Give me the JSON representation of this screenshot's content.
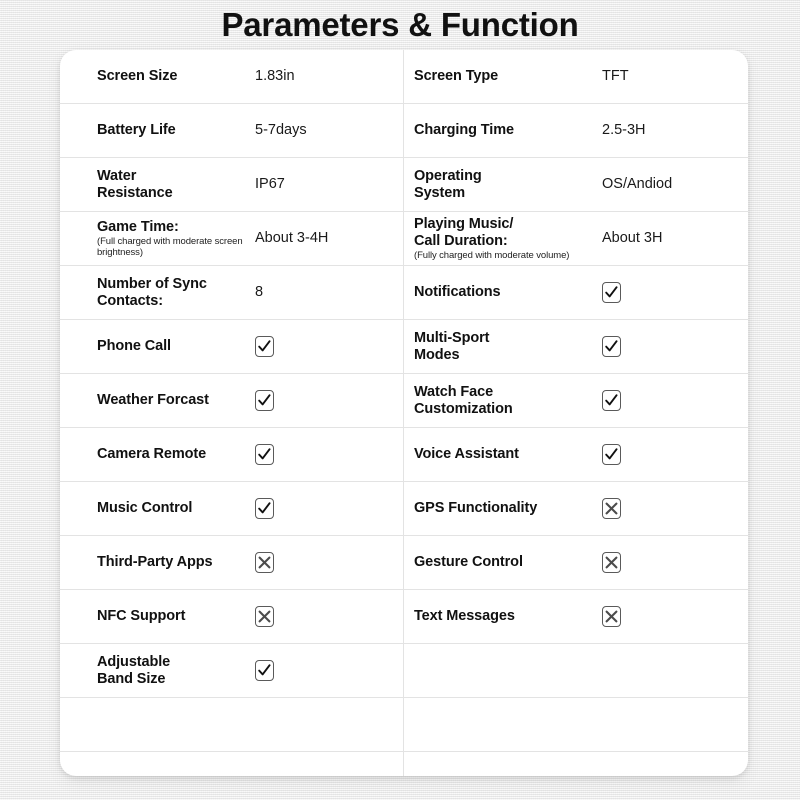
{
  "page": {
    "title": "Parameters & Function",
    "background_color": "#eeeeee",
    "card_color": "#ffffff",
    "divider_color": "#e3e3e3",
    "text_color": "#111111",
    "checkbox_border_color": "#5a5a5a"
  },
  "icons": {
    "check": "check-icon",
    "cross": "cross-icon"
  },
  "table": {
    "rows": [
      {
        "left": {
          "label": "Screen Size",
          "sub": "",
          "value": "1.83in",
          "mark": ""
        },
        "right": {
          "label": "Screen Type",
          "sub": "",
          "value": "TFT",
          "mark": ""
        }
      },
      {
        "left": {
          "label": "Battery Life",
          "sub": "",
          "value": "5-7days",
          "mark": ""
        },
        "right": {
          "label": "Charging Time",
          "sub": "",
          "value": "2.5-3H",
          "mark": ""
        }
      },
      {
        "left": {
          "label": "Water\nResistance",
          "sub": "",
          "value": "IP67",
          "mark": ""
        },
        "right": {
          "label": "Operating\nSystem",
          "sub": "",
          "value": "OS/Andiod",
          "mark": ""
        }
      },
      {
        "left": {
          "label": "Game Time:",
          "sub": "(Full charged with moderate screen brightness)",
          "value": "About 3-4H",
          "mark": ""
        },
        "right": {
          "label": "Playing Music/\nCall Duration:",
          "sub": "(Fully charged with moderate volume)",
          "value": "About 3H",
          "mark": ""
        }
      },
      {
        "left": {
          "label": "Number of Sync\nContacts:",
          "sub": "",
          "value": "8",
          "mark": ""
        },
        "right": {
          "label": "Notifications",
          "sub": "",
          "value": "",
          "mark": "check"
        }
      },
      {
        "left": {
          "label": "Phone Call",
          "sub": "",
          "value": "",
          "mark": "check"
        },
        "right": {
          "label": "Multi-Sport\nModes",
          "sub": "",
          "value": "",
          "mark": "check"
        }
      },
      {
        "left": {
          "label": "Weather Forcast",
          "sub": "",
          "value": "",
          "mark": "check"
        },
        "right": {
          "label": "Watch Face\nCustomization",
          "sub": "",
          "value": "",
          "mark": "check"
        }
      },
      {
        "left": {
          "label": "Camera Remote",
          "sub": "",
          "value": "",
          "mark": "check"
        },
        "right": {
          "label": "Voice Assistant",
          "sub": "",
          "value": "",
          "mark": "check"
        }
      },
      {
        "left": {
          "label": "Music Control",
          "sub": "",
          "value": "",
          "mark": "check"
        },
        "right": {
          "label": "GPS Functionality",
          "sub": "",
          "value": "",
          "mark": "cross"
        }
      },
      {
        "left": {
          "label": "Third-Party Apps",
          "sub": "",
          "value": "",
          "mark": "cross"
        },
        "right": {
          "label": "Gesture Control",
          "sub": "",
          "value": "",
          "mark": "cross"
        }
      },
      {
        "left": {
          "label": "NFC Support",
          "sub": "",
          "value": "",
          "mark": "cross"
        },
        "right": {
          "label": "Text Messages",
          "sub": "",
          "value": "",
          "mark": "cross"
        }
      },
      {
        "left": {
          "label": "Adjustable\nBand Size",
          "sub": "",
          "value": "",
          "mark": "check"
        },
        "right": {
          "label": "",
          "sub": "",
          "value": "",
          "mark": ""
        }
      },
      {
        "left": {
          "label": "",
          "sub": "",
          "value": "",
          "mark": ""
        },
        "right": {
          "label": "",
          "sub": "",
          "value": "",
          "mark": ""
        }
      },
      {
        "left": {
          "label": "",
          "sub": "",
          "value": "",
          "mark": ""
        },
        "right": {
          "label": "",
          "sub": "",
          "value": "",
          "mark": ""
        }
      }
    ]
  }
}
